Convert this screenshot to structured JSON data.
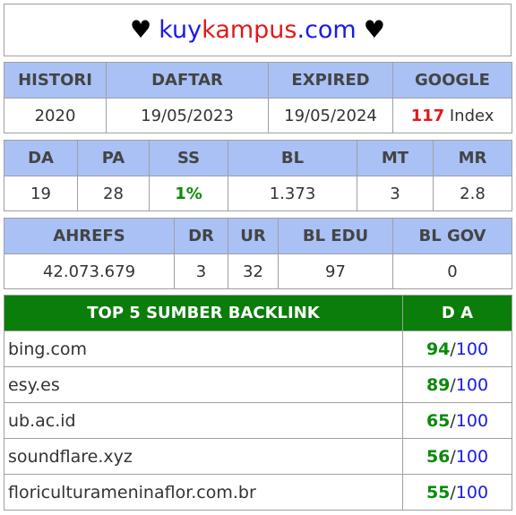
{
  "title": {
    "heart_left": "♥",
    "part1": "kuy",
    "part2": "kampus",
    "part3": ".com",
    "heart_right": "♥"
  },
  "domain_info": {
    "headers": [
      "HISTORI",
      "DAFTAR",
      "EXPIRED",
      "GOOGLE"
    ],
    "histori": "2020",
    "daftar": "19/05/2023",
    "expired": "19/05/2024",
    "google_count": "117",
    "google_suffix": "Index"
  },
  "metrics": {
    "headers": [
      "DA",
      "PA",
      "SS",
      "BL",
      "MT",
      "MR"
    ],
    "values": [
      "19",
      "28",
      "1%",
      "1.373",
      "3",
      "2.8"
    ]
  },
  "ahrefs": {
    "headers": [
      "AHREFS",
      "DR",
      "UR",
      "BL EDU",
      "BL GOV"
    ],
    "values": [
      "42.073.679",
      "3",
      "32",
      "97",
      "0"
    ]
  },
  "backlinks": {
    "header_sites": "TOP 5 SUMBER BACKLINK",
    "header_da": "D A",
    "max": "100",
    "rows": [
      {
        "site": "bing.com",
        "da": "94"
      },
      {
        "site": "esy.es",
        "da": "89"
      },
      {
        "site": "ub.ac.id",
        "da": "65"
      },
      {
        "site": "soundflare.xyz",
        "da": "56"
      },
      {
        "site": "floriculturameninaflor.com.br",
        "da": "55"
      }
    ]
  }
}
